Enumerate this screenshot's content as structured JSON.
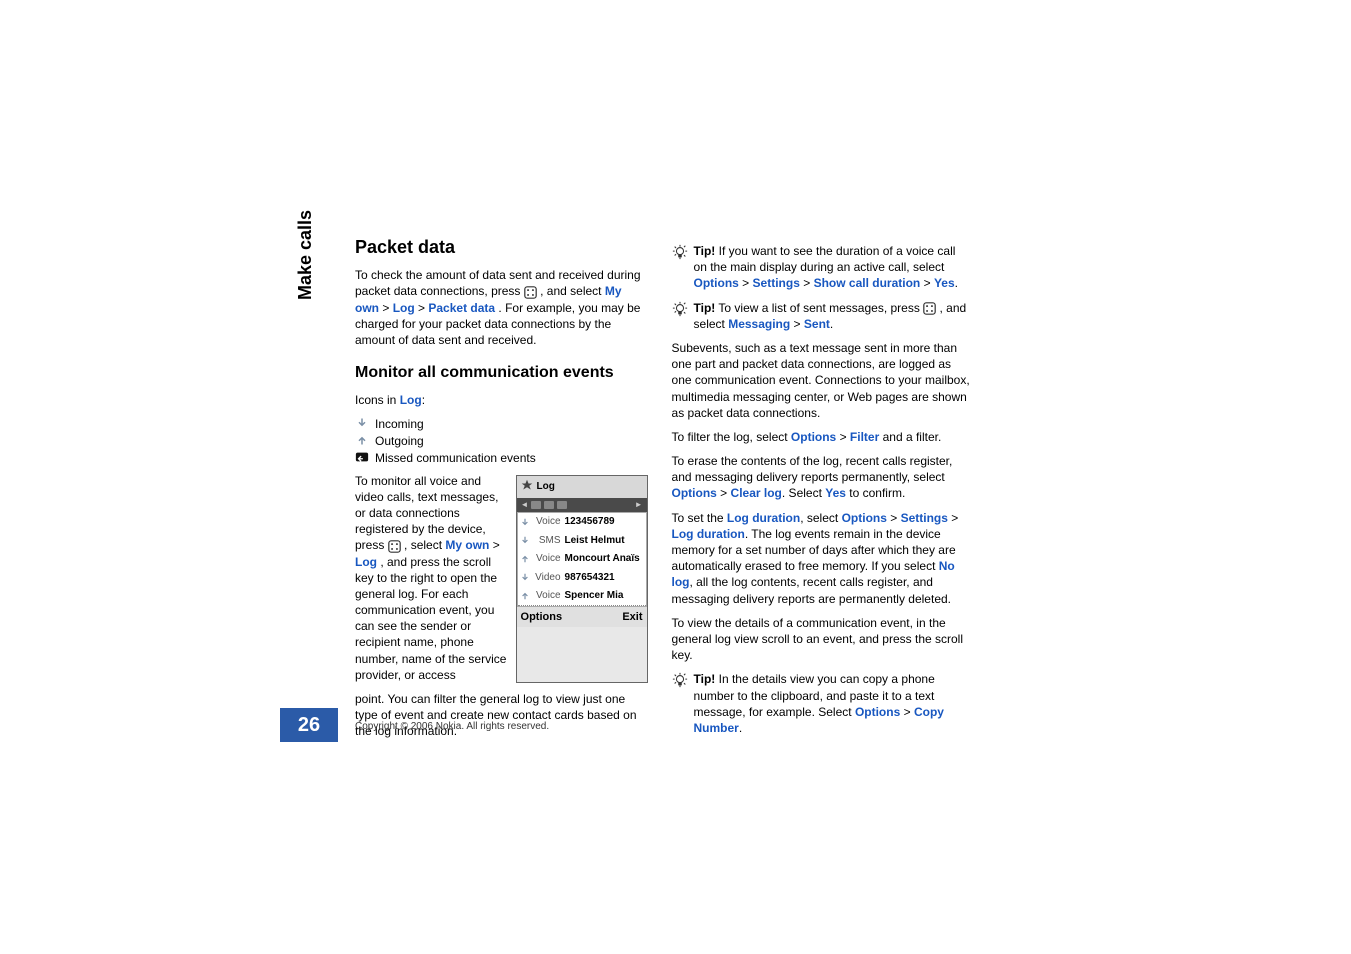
{
  "sidebar_label": "Make calls",
  "page_number": "26",
  "copyright": "Copyright © 2006 Nokia. All rights reserved.",
  "left": {
    "h2": "Packet data",
    "p1_a": "To check the amount of data sent and received during packet data connections, press ",
    "p1_b": ", and select ",
    "p1_myown": "My own",
    "p1_gt": " > ",
    "p1_log": "Log",
    "p1_packet": "Packet data",
    "p1_end": ". For example, you may be charged for your packet data connections by the amount of data sent and received.",
    "h3": "Monitor all communication events",
    "icons_intro_a": "Icons in ",
    "icons_intro_b": "Log",
    "icons_intro_c": ":",
    "icon_incoming": "Incoming",
    "icon_outgoing": "Outgoing",
    "icon_missed": "Missed communication events",
    "wrap_a": "To monitor all voice and video calls, text messages, or data connections registered by the device, press ",
    "wrap_b": ", select ",
    "wrap_myown": "My own",
    "wrap_gt": " > ",
    "wrap_log": "Log",
    "wrap_c": ", and press the scroll key to the right to open the general log. For each communication event, you can see the sender or recipient name, phone number, name of the service provider, or access ",
    "after": "point. You can filter the general log to view just one type of event and create new contact cards based on the log information.",
    "phone": {
      "title": "Log",
      "items": [
        {
          "dir": "in",
          "type": "Voice",
          "name": "123456789"
        },
        {
          "dir": "in",
          "type": "SMS",
          "name": "Leist Helmut"
        },
        {
          "dir": "out",
          "type": "Voice",
          "name": "Moncourt Anaïs"
        },
        {
          "dir": "in",
          "type": "Video",
          "name": "987654321"
        },
        {
          "dir": "out",
          "type": "Voice",
          "name": "Spencer Mia"
        }
      ],
      "soft_left": "Options",
      "soft_right": "Exit"
    }
  },
  "right": {
    "tip1_a": "Tip!",
    "tip1_b": " If you want to see the duration of a voice call on the main display during an active call, select ",
    "tip1_options": "Options",
    "tip1_gt": " > ",
    "tip1_settings": "Settings",
    "tip1_show": "Show call duration",
    "tip1_yes": "Yes",
    "tip1_end": ".",
    "tip2_a": "Tip!",
    "tip2_b": " To view a list of sent messages, press ",
    "tip2_c": ", and select ",
    "tip2_messaging": "Messaging",
    "tip2_gt": " > ",
    "tip2_sent": "Sent",
    "tip2_end": ".",
    "p_sub": "Subevents, such as a text message sent in more than one part and packet data connections, are logged as one communication event. Connections to your mailbox, multimedia messaging center, or Web pages are shown as packet data connections.",
    "p_filter_a": "To filter the log, select ",
    "p_filter_options": "Options",
    "p_filter_gt": " > ",
    "p_filter_filter": "Filter",
    "p_filter_end": " and a filter.",
    "p_erase_a": "To erase the contents of the log, recent calls register, and messaging delivery reports permanently, select ",
    "p_erase_options": "Options",
    "p_erase_gt": " > ",
    "p_erase_clear": "Clear log",
    "p_erase_b": ". Select ",
    "p_erase_yes": "Yes",
    "p_erase_end": " to confirm.",
    "p_dur_a": "To set the ",
    "p_dur_logdur": "Log duration",
    "p_dur_b": ", select ",
    "p_dur_options": "Options",
    "p_dur_gt": " > ",
    "p_dur_settings": "Settings",
    "p_dur_logdur2": "Log duration",
    "p_dur_c": ". The log events remain in the device memory for a set number of days after which they are automatically erased to free memory. If you select ",
    "p_dur_nolog": "No log",
    "p_dur_end": ", all the log contents, recent calls register, and messaging delivery reports are permanently deleted.",
    "p_view": "To view the details of a communication event, in the general log view scroll to an event, and press the scroll key.",
    "tip3_a": "Tip!",
    "tip3_b": " In the details view you can copy a phone number to the clipboard, and paste it to a text message, for example. Select ",
    "tip3_options": "Options",
    "tip3_gt": " > ",
    "tip3_copy": "Copy Number",
    "tip3_end": "."
  }
}
